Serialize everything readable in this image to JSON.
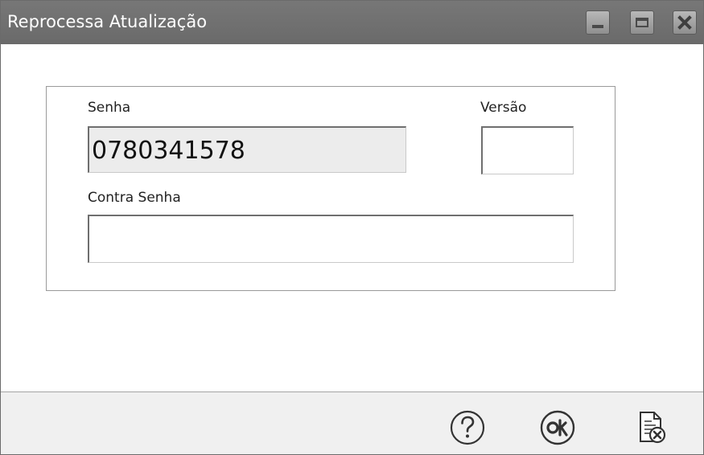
{
  "window": {
    "title": "Reprocessa Atualização"
  },
  "form": {
    "senha_label": "Senha",
    "senha_value": "0780341578",
    "versao_label": "Versão",
    "versao_value": "",
    "contra_senha_label": "Contra Senha",
    "contra_senha_value": ""
  },
  "footer": {
    "help_icon": "question-circle-icon",
    "ok_icon": "ok-circle-icon",
    "cancel_icon": "document-cancel-icon"
  },
  "colors": {
    "titlebar": "#707070",
    "footer_bg": "#f0f0f0",
    "readonly_field": "#ececec"
  }
}
